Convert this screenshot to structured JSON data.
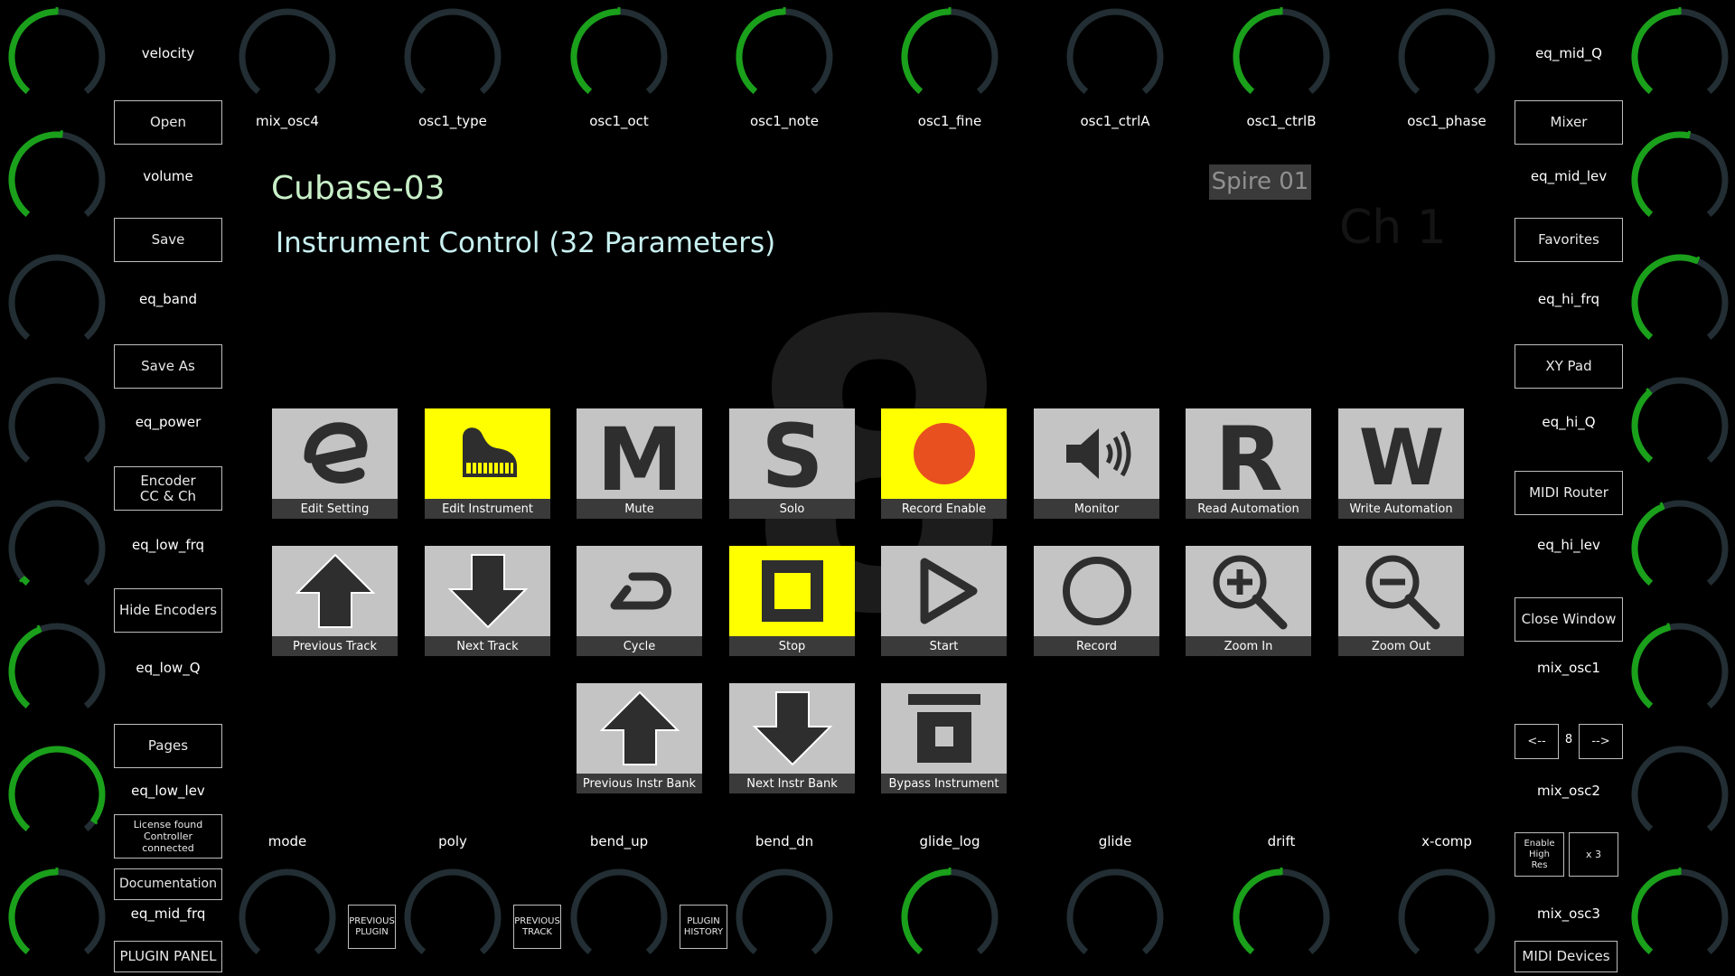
{
  "title": "Cubase-03",
  "subtitle": "Instrument Control (32 Parameters)",
  "plugin_badge": "Spire 01",
  "channel_label": "Ch 1",
  "watermark_glyph": "8",
  "colors": {
    "active_arc": "#1aa01a",
    "idle_arc": "#222e33",
    "pad_face": "#c4c4c4",
    "pad_on": "#ffff00",
    "title": "#c8f0c8",
    "subtitle": "#c8f0f0"
  },
  "top_params": [
    "mix_osc4",
    "osc1_type",
    "osc1_oct",
    "osc1_note",
    "osc1_fine",
    "osc1_ctrlA",
    "osc1_ctrlB",
    "osc1_phase"
  ],
  "bottom_params": [
    "mode",
    "poly",
    "bend_up",
    "bend_dn",
    "glide_log",
    "glide",
    "drift",
    "x-comp"
  ],
  "left_params": [
    "velocity",
    "volume",
    "eq_band",
    "eq_power",
    "eq_low_frq",
    "eq_low_Q",
    "eq_low_lev",
    "eq_mid_frq"
  ],
  "right_params": [
    "eq_mid_Q",
    "eq_mid_lev",
    "eq_hi_frq",
    "eq_hi_Q",
    "eq_hi_lev",
    "mix_osc1",
    "mix_osc2",
    "mix_osc3"
  ],
  "left_buttons": {
    "open": "Open",
    "save": "Save",
    "save_as": "Save As",
    "encoder_cc_ch": "Encoder\nCC & Ch",
    "hide_encoders": "Hide Encoders",
    "pages": "Pages",
    "license": "License found\nController\nconnected",
    "documentation": "Documentation",
    "plugin_panel": "PLUGIN PANEL"
  },
  "right_buttons": {
    "mixer": "Mixer",
    "favorites": "Favorites",
    "xy_pad": "XY Pad",
    "midi_router": "MIDI Router",
    "close_window": "Close Window",
    "prev_page": "<--",
    "page_number": "8",
    "next_page": "-->",
    "enable_high_res": "Enable\nHigh\nRes",
    "multiplier": "x 3",
    "midi_devices": "MIDI Devices"
  },
  "bottom_small_buttons": [
    "PREVIOUS\nPLUGIN",
    "PREVIOUS\nTRACK",
    "PLUGIN\nHISTORY"
  ],
  "pads": [
    {
      "label": "Edit Setting",
      "icon": "edit-e-icon",
      "on": false
    },
    {
      "label": "Edit Instrument",
      "icon": "piano-icon",
      "on": true
    },
    {
      "label": "Mute",
      "icon": "mute-m-icon",
      "on": false
    },
    {
      "label": "Solo",
      "icon": "solo-s-icon",
      "on": false
    },
    {
      "label": "Record Enable",
      "icon": "record-dot-icon",
      "on": true
    },
    {
      "label": "Monitor",
      "icon": "speaker-icon",
      "on": false
    },
    {
      "label": "Read Automation",
      "icon": "read-r-icon",
      "on": false
    },
    {
      "label": "Write Automation",
      "icon": "write-w-icon",
      "on": false
    },
    {
      "label": "Previous Track",
      "icon": "arrow-up-icon",
      "on": false
    },
    {
      "label": "Next Track",
      "icon": "arrow-down-icon",
      "on": false
    },
    {
      "label": "Cycle",
      "icon": "cycle-icon",
      "on": false
    },
    {
      "label": "Stop",
      "icon": "stop-icon",
      "on": true
    },
    {
      "label": "Start",
      "icon": "play-icon",
      "on": false
    },
    {
      "label": "Record",
      "icon": "record-ring-icon",
      "on": false
    },
    {
      "label": "Zoom In",
      "icon": "zoom-in-icon",
      "on": false
    },
    {
      "label": "Zoom Out",
      "icon": "zoom-out-icon",
      "on": false
    },
    {
      "label": "Previous Instr Bank",
      "icon": "arrow-up-icon",
      "on": false
    },
    {
      "label": "Next Instr Bank",
      "icon": "arrow-down-icon",
      "on": false
    },
    {
      "label": "Bypass Instrument",
      "icon": "bypass-icon",
      "on": false
    }
  ],
  "knob_levels": {
    "top": [
      0.5,
      0.0,
      0.0,
      0.5,
      0.5,
      0.5,
      0.0,
      0.5,
      0.0,
      0.5
    ],
    "bottom": [
      0.5,
      0.0,
      0.0,
      0.0,
      0.0,
      0.5,
      0.0,
      0.5,
      0.0,
      0.5
    ],
    "left_mid": [
      0.52,
      0.0,
      0.0,
      0.03,
      0.42,
      0.95
    ],
    "right_mid": [
      0.54,
      0.58,
      0.35,
      0.42,
      0.45,
      0.0
    ]
  }
}
